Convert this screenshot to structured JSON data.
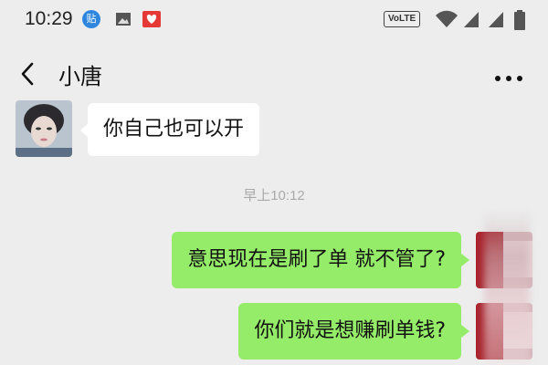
{
  "status_bar": {
    "time": "10:29",
    "notifications": [
      {
        "icon": "paste-notification-icon",
        "label": "贴"
      },
      {
        "icon": "image-notification-icon"
      },
      {
        "icon": "app-notification-icon"
      }
    ],
    "network_badge": "VoLTE",
    "system_icons": [
      "wifi-icon",
      "signal-icon",
      "signal-icon",
      "battery-icon"
    ]
  },
  "nav": {
    "back_icon": "chevron-left-icon",
    "title": "小唐",
    "more_icon": "more-dots-icon"
  },
  "messages": [
    {
      "direction": "incoming",
      "text": "你自己也可以开"
    },
    {
      "type": "timestamp",
      "text": "早上10:12"
    },
    {
      "direction": "outgoing",
      "text": "意思现在是刷了单  就不管了?"
    },
    {
      "direction": "outgoing",
      "text": "你们就是想赚刷单钱?"
    }
  ],
  "colors": {
    "background": "#ededed",
    "incoming_bubble": "#ffffff",
    "outgoing_bubble": "#95ec69",
    "timestamp": "#a9a9a9"
  }
}
